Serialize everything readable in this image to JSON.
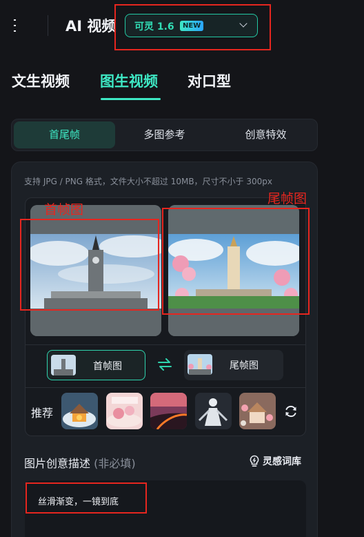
{
  "header": {
    "menu_icon": "hamburger-menu-icon",
    "title": "AI 视频",
    "model": {
      "name": "可灵 1.6",
      "badge": "NEW",
      "chevron_icon": "chevron-down-icon"
    }
  },
  "main_tabs": [
    {
      "label": "文生视频",
      "active": false
    },
    {
      "label": "图生视频",
      "active": true
    },
    {
      "label": "对口型",
      "active": false
    }
  ],
  "sub_tabs": [
    {
      "label": "首尾帧",
      "active": true
    },
    {
      "label": "多图参考",
      "active": false
    },
    {
      "label": "创意特效",
      "active": false
    }
  ],
  "upload": {
    "hint": "支持 JPG / PNG 格式，文件大小不超过 10MB，尺寸不小于 300px",
    "first_frame_annotation": "首帧图",
    "last_frame_annotation": "尾帧图",
    "first_pill_label": "首帧图",
    "last_pill_label": "尾帧图",
    "swap_icon": "swap-arrows-icon"
  },
  "recommend": {
    "label": "推荐",
    "thumbnails": [
      "snow-cottage-thumbnail",
      "pink-candy-thumbnail",
      "lava-road-thumbnail",
      "white-figure-thumbnail",
      "flower-house-thumbnail"
    ],
    "refresh_icon": "refresh-icon"
  },
  "description": {
    "title": "图片创意描述",
    "optional": "(非必填)",
    "inspire_label": "灵感词库",
    "inspire_icon": "lightbulb-icon",
    "prompt_text": "丝滑渐变，一镜到底"
  },
  "colors": {
    "accent": "#3EE8C4",
    "background": "#141519",
    "panel": "#1C2026",
    "annotation_red": "#E6261F"
  }
}
